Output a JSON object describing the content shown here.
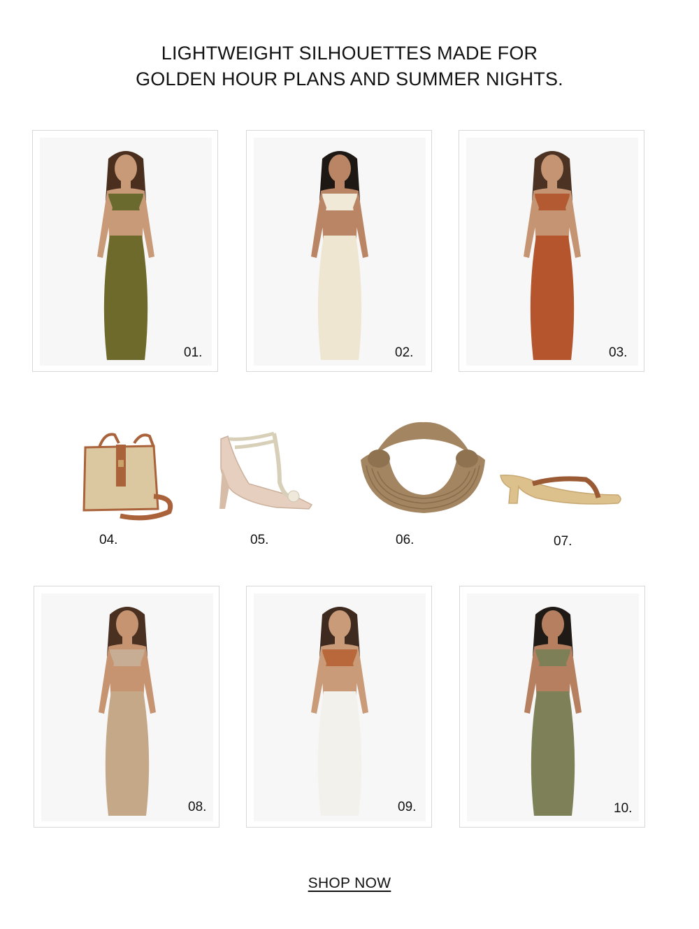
{
  "headline": {
    "line1": "LIGHTWEIGHT SILHOUETTES MADE FOR",
    "line2": "GOLDEN HOUR PLANS AND SUMMER NIGHTS."
  },
  "outfits_row1": [
    {
      "number": "01.",
      "colors": {
        "top": "#6b6a2e",
        "bottom": "#6e6a2c",
        "skin": "#c99a78",
        "hair": "#4a2f1f"
      }
    },
    {
      "number": "02.",
      "colors": {
        "top": "#f1e9d8",
        "bottom": "#efe6d2",
        "skin": "#b98564",
        "hair": "#1d1814"
      }
    },
    {
      "number": "03.",
      "colors": {
        "top": "#b35a32",
        "bottom": "#b4552e",
        "skin": "#c49473",
        "hair": "#4b3222"
      }
    }
  ],
  "accessories": [
    {
      "number": "04.",
      "icon": "straw-bag-icon",
      "colors": {
        "main": "#dcc8a0",
        "trim": "#a9623a"
      }
    },
    {
      "number": "05.",
      "icon": "heeled-sandal-icon",
      "colors": {
        "main": "#e6cfbe",
        "trim": "#d8cfb8"
      }
    },
    {
      "number": "06.",
      "icon": "knot-handbag-icon",
      "colors": {
        "main": "#a38661",
        "trim": "#8a6d4b"
      }
    },
    {
      "number": "07.",
      "icon": "thong-mule-icon",
      "colors": {
        "main": "#ddc18d",
        "trim": "#9a5a34"
      }
    }
  ],
  "outfits_row2": [
    {
      "number": "08.",
      "colors": {
        "top": "#c7ad93",
        "bottom": "#c4a888",
        "skin": "#c69471",
        "hair": "#4a3020"
      }
    },
    {
      "number": "09.",
      "colors": {
        "top": "#b8683a",
        "bottom": "#f3f1ec",
        "skin": "#c99b78",
        "hair": "#3e2a1e"
      }
    },
    {
      "number": "10.",
      "colors": {
        "top": "#7d7f56",
        "bottom": "#7e8158",
        "skin": "#b68060",
        "hair": "#1f1a16"
      }
    }
  ],
  "cta": {
    "label": "SHOP NOW"
  }
}
